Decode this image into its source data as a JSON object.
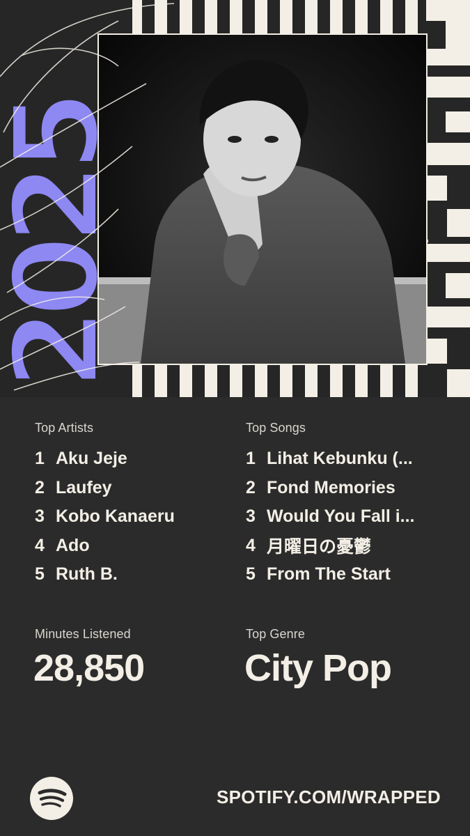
{
  "year_art": "2025",
  "colors": {
    "background": "#2b2b2b",
    "cream": "#f3efe6",
    "accent_purple": "#8d88f2"
  },
  "top_artists": {
    "label": "Top Artists",
    "items": [
      {
        "rank": "1",
        "name": "Aku Jeje"
      },
      {
        "rank": "2",
        "name": "Laufey"
      },
      {
        "rank": "3",
        "name": "Kobo Kanaeru"
      },
      {
        "rank": "4",
        "name": "Ado"
      },
      {
        "rank": "5",
        "name": "Ruth B."
      }
    ]
  },
  "top_songs": {
    "label": "Top Songs",
    "items": [
      {
        "rank": "1",
        "name": "Lihat Kebunku (..."
      },
      {
        "rank": "2",
        "name": "Fond Memories"
      },
      {
        "rank": "3",
        "name": "Would You Fall i..."
      },
      {
        "rank": "4",
        "name": "月曜日の憂鬱"
      },
      {
        "rank": "5",
        "name": "From The Start"
      }
    ]
  },
  "minutes": {
    "label": "Minutes Listened",
    "value": "28,850"
  },
  "genre": {
    "label": "Top Genre",
    "value": "City Pop"
  },
  "footer": {
    "url": "SPOTIFY.COM/WRAPPED",
    "logo_icon": "spotify-logo-icon"
  }
}
